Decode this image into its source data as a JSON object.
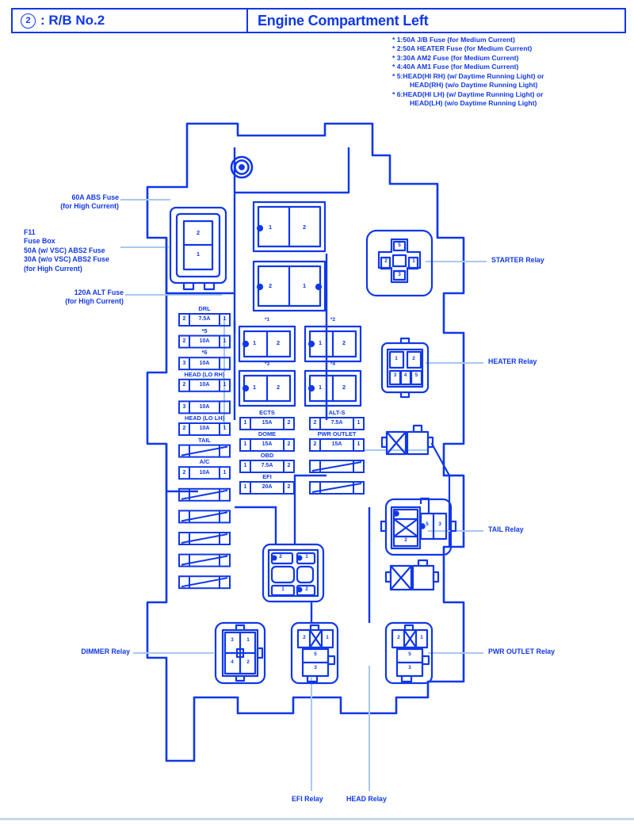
{
  "header": {
    "badge": "2",
    "left_title": ": R/B No.2",
    "right_title": "Engine Compartment Left"
  },
  "legend": {
    "lines": [
      "* 1:50A J/B Fuse (for Medium Current)",
      "* 2:50A HEATER Fuse (for Medium Current)",
      "* 3:30A AM2 Fuse (for Medium Current)",
      "* 4:40A AM1 Fuse (for Medium Current)",
      "* 5:HEAD(HI RH) (w/ Daytime Running Light) or",
      "HEAD(RH) (w/o Daytime Running Light)",
      "* 6:HEAD(HI LH) (w/ Daytime Running Light) or",
      "HEAD(LH) (w/o Daytime Running Light)"
    ]
  },
  "callouts": {
    "abs_fuse": "60A ABS Fuse\n(for High Current)",
    "abs_fuse_l1": "60A ABS Fuse",
    "abs_fuse_l2": "(for High Current)",
    "fusebox_l1": "F11",
    "fusebox_l2": "Fuse Box",
    "fusebox_l3": "50A (w/ VSC) ABS2 Fuse",
    "fusebox_l4": "30A (w/o VSC) ABS2 Fuse",
    "fusebox_l5": "(for High Current)",
    "alt_fuse_l1": "120A ALT Fuse",
    "alt_fuse_l2": "(for High Current)",
    "starter_relay": "STARTER Relay",
    "heater_relay": "HEATER Relay",
    "tail_relay": "TAIL Relay",
    "pwr_outlet_relay": "PWR OUTLET Relay",
    "dimmer_relay": "DIMMER Relay",
    "efi_relay": "EFI Relay",
    "head_relay": "HEAD Relay"
  },
  "fuse_column": [
    {
      "name": "DRL",
      "left": "2",
      "amp": "7.5A",
      "right": "1"
    },
    {
      "name": "*5",
      "left": "2",
      "amp": "10A",
      "right": "1"
    },
    {
      "name": "*6",
      "left": "3",
      "amp": "10A",
      "right": ""
    },
    {
      "name": "HEAD (LO RH)",
      "left": "2",
      "amp": "10A",
      "right": "1"
    },
    {
      "name": "",
      "left": "3",
      "amp": "10A",
      "right": ""
    },
    {
      "name": "HEAD (LO LH)",
      "left": "2",
      "amp": "10A",
      "right": "1"
    },
    {
      "name": "TAIL",
      "left": "",
      "amp": "",
      "right": ""
    },
    {
      "name": "A/C",
      "left": "2",
      "amp": "10A",
      "right": "1"
    },
    {
      "name": "",
      "left": "",
      "amp": "",
      "right": ""
    },
    {
      "name": "",
      "left": "",
      "amp": "",
      "right": ""
    },
    {
      "name": "",
      "left": "",
      "amp": "",
      "right": ""
    },
    {
      "name": "",
      "left": "",
      "amp": "",
      "right": ""
    },
    {
      "name": "",
      "left": "",
      "amp": "",
      "right": ""
    }
  ],
  "center_fuses_left": [
    {
      "name": "ECTS",
      "left": "1",
      "amp": "15A",
      "right": "2"
    },
    {
      "name": "DOME",
      "left": "1",
      "amp": "15A",
      "right": "2"
    },
    {
      "name": "OBD",
      "left": "1",
      "amp": "7.5A",
      "right": "2"
    },
    {
      "name": "EFI",
      "left": "1",
      "amp": "20A",
      "right": "2"
    }
  ],
  "center_fuses_right": [
    {
      "name": "ALT-S",
      "left": "2",
      "amp": "7.5A",
      "right": "1"
    },
    {
      "name": "PWR OUTLET",
      "left": "2",
      "amp": "15A",
      "right": "1"
    }
  ],
  "big_blocks": [
    {
      "id": "abs",
      "top": "2",
      "bottom": "1"
    },
    {
      "id": "jb1",
      "left": "1",
      "right": "2"
    },
    {
      "id": "alt",
      "left": "2",
      "right": "1"
    }
  ],
  "star_blocks": [
    {
      "name": "*1",
      "left": "1",
      "right": "2"
    },
    {
      "name": "*2",
      "left": "1",
      "right": "2"
    },
    {
      "name": "*3",
      "left": "1",
      "right": "2"
    },
    {
      "name": "*4",
      "left": "1",
      "right": "2"
    }
  ],
  "relays": {
    "starter": {
      "terminals": [
        "5",
        "2",
        "1",
        "3"
      ]
    },
    "heater": {
      "top": [
        "1",
        "2"
      ],
      "bottom": [
        "3",
        "4",
        "5"
      ]
    },
    "tail": {
      "terminals": [
        "2",
        "5",
        "3"
      ]
    },
    "dimmer": {
      "terminals": [
        "3",
        "1",
        "4",
        "2"
      ]
    },
    "efi": {
      "terminals": [
        "2",
        "1",
        "5",
        "3"
      ]
    },
    "pwr_outlet": {
      "terminals": [
        "2",
        "1",
        "5",
        "3"
      ]
    },
    "center_block": {
      "terminals": [
        "2",
        "1",
        "1",
        "2"
      ]
    }
  },
  "colors": {
    "primary": "#1038e8",
    "secondary": "#a8c8f0",
    "footer": "#c9d9f2"
  }
}
